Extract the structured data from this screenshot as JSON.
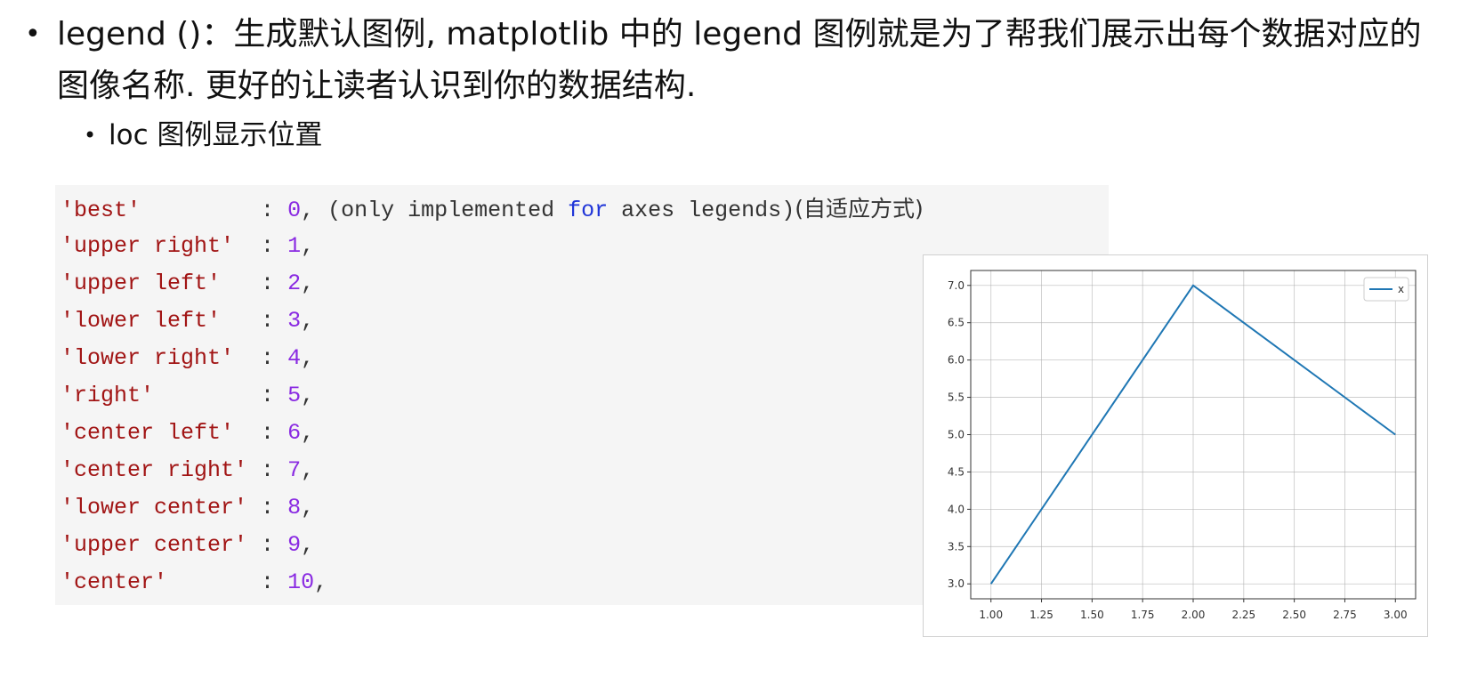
{
  "bullets": {
    "main_marker": "•",
    "main_text": "legend ()：生成默认图例, matplotlib 中的 legend 图例就是为了帮我们展示出每个数据对应的图像名称. 更好的让读者认识到你的数据结构.",
    "sub_marker": "•",
    "sub_text": "loc 图例显示位置"
  },
  "code": {
    "lines": [
      {
        "str": "'best'         ",
        "sep": ": ",
        "num": "0",
        "rest": ", (only implemented ",
        "kw": "for",
        "rest2": " axes legends)",
        "han": "(自适应方式)"
      },
      {
        "str": "'upper right'  ",
        "sep": ": ",
        "num": "1",
        "rest": ",",
        "kw": "",
        "rest2": "",
        "han": ""
      },
      {
        "str": "'upper left'   ",
        "sep": ": ",
        "num": "2",
        "rest": ",",
        "kw": "",
        "rest2": "",
        "han": ""
      },
      {
        "str": "'lower left'   ",
        "sep": ": ",
        "num": "3",
        "rest": ",",
        "kw": "",
        "rest2": "",
        "han": ""
      },
      {
        "str": "'lower right'  ",
        "sep": ": ",
        "num": "4",
        "rest": ",",
        "kw": "",
        "rest2": "",
        "han": ""
      },
      {
        "str": "'right'        ",
        "sep": ": ",
        "num": "5",
        "rest": ",",
        "kw": "",
        "rest2": "",
        "han": ""
      },
      {
        "str": "'center left'  ",
        "sep": ": ",
        "num": "6",
        "rest": ",",
        "kw": "",
        "rest2": "",
        "han": ""
      },
      {
        "str": "'center right' ",
        "sep": ": ",
        "num": "7",
        "rest": ",",
        "kw": "",
        "rest2": "",
        "han": ""
      },
      {
        "str": "'lower center' ",
        "sep": ": ",
        "num": "8",
        "rest": ",",
        "kw": "",
        "rest2": "",
        "han": ""
      },
      {
        "str": "'upper center' ",
        "sep": ": ",
        "num": "9",
        "rest": ",",
        "kw": "",
        "rest2": "",
        "han": ""
      },
      {
        "str": "'center'       ",
        "sep": ": ",
        "num": "10",
        "rest": ",",
        "kw": "",
        "rest2": "",
        "han": ""
      }
    ]
  },
  "chart_data": {
    "type": "line",
    "x": [
      1.0,
      2.0,
      3.0
    ],
    "series": [
      {
        "name": "x",
        "values": [
          3.0,
          7.0,
          5.0
        ],
        "color": "#1f77b4"
      }
    ],
    "x_ticks": [
      "1.00",
      "1.25",
      "1.50",
      "1.75",
      "2.00",
      "2.25",
      "2.50",
      "2.75",
      "3.00"
    ],
    "y_ticks": [
      "3.0",
      "3.5",
      "4.0",
      "4.5",
      "5.0",
      "5.5",
      "6.0",
      "6.5",
      "7.0"
    ],
    "xlim": [
      0.9,
      3.1
    ],
    "ylim": [
      2.8,
      7.2
    ],
    "grid": true,
    "legend_position": "top-right"
  }
}
